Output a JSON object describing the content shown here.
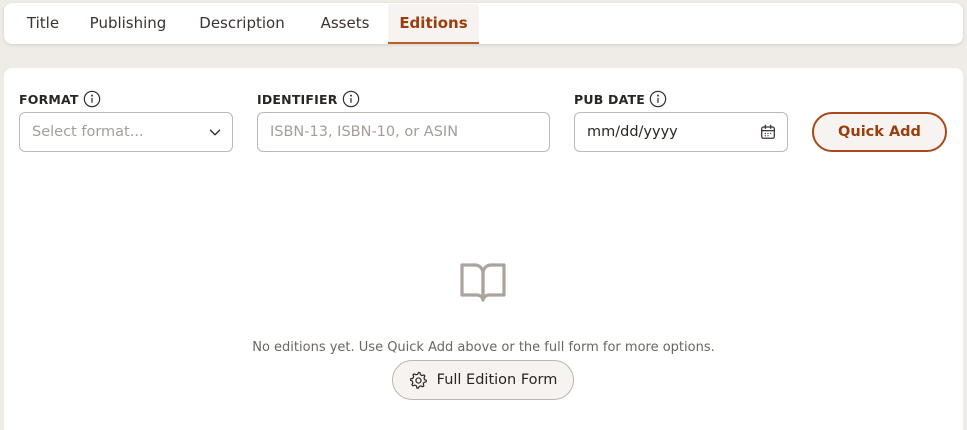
{
  "tabs": [
    {
      "label": "Title"
    },
    {
      "label": "Publishing"
    },
    {
      "label": "Description"
    },
    {
      "label": "Assets"
    },
    {
      "label": "Editions",
      "active": true
    }
  ],
  "quick_add_form": {
    "format": {
      "label": "FORMAT",
      "placeholder": "Select format..."
    },
    "identifier": {
      "label": "IDENTIFIER",
      "placeholder": "ISBN-13, ISBN-10, or ASIN"
    },
    "pub_date": {
      "label": "PUB DATE",
      "value": "mm/dd/yyyy"
    },
    "quick_add_label": "Quick Add"
  },
  "empty_state": {
    "icon": "open-book-icon",
    "message": "No editions yet. Use Quick Add above or the full form for more options.",
    "full_form_label": "Full Edition Form",
    "full_form_icon": "gear-icon"
  },
  "colors": {
    "accent": "#9a3e0e",
    "accent_border": "#a8491a",
    "page_background": "#efebe7",
    "card_background": "#ffffff"
  }
}
